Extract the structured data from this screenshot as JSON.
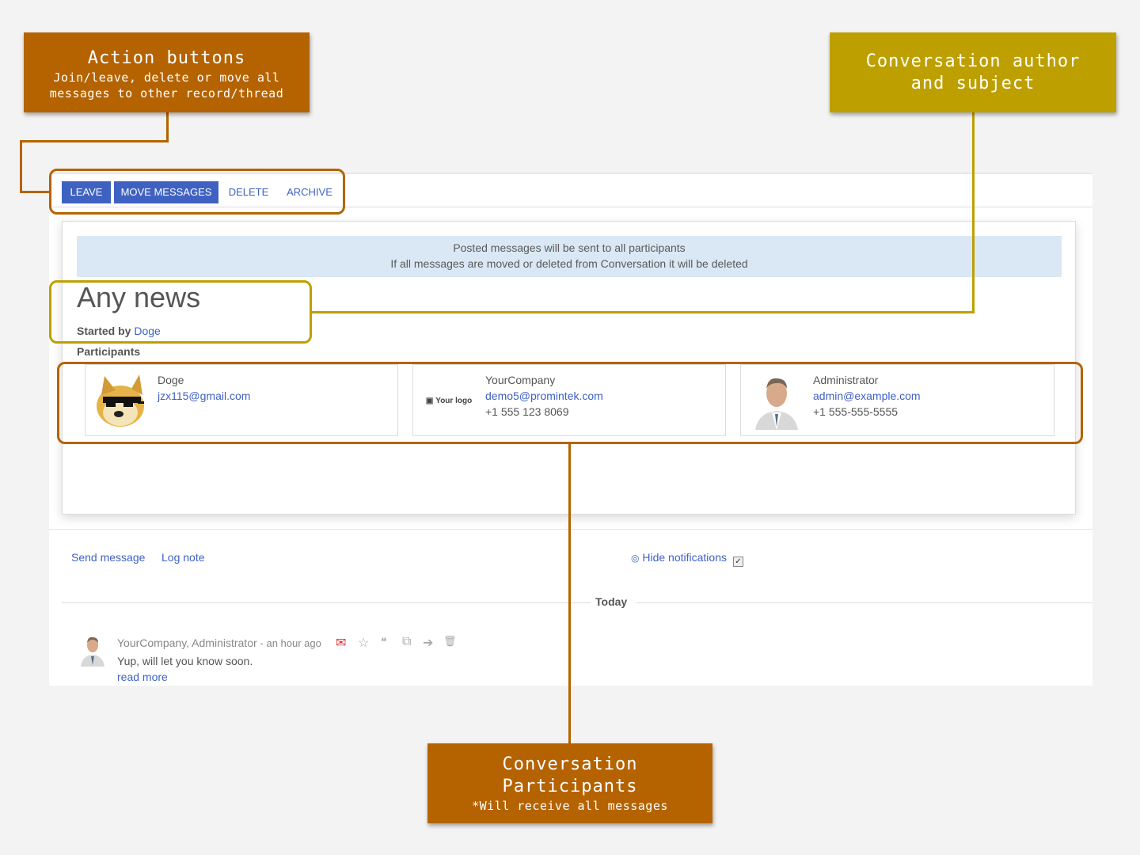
{
  "callouts": {
    "actions": {
      "title": "Action buttons",
      "subtitle": "Join/leave, delete or move all messages to other record/thread"
    },
    "author": {
      "title": "Conversation author and subject"
    },
    "participants": {
      "title": "Conversation Participants",
      "subtitle": "*Will receive all messages"
    }
  },
  "toolbar": {
    "leave_label": "LEAVE",
    "move_label": "MOVE MESSAGES",
    "delete_label": "DELETE",
    "archive_label": "ARCHIVE"
  },
  "banner": {
    "line1": "Posted messages will be sent to all participants",
    "line2": "If all messages are moved or deleted from Conversation it will be deleted"
  },
  "conversation": {
    "subject": "Any news",
    "started_by_label": "Started by",
    "author": "Doge",
    "participants_label": "Participants"
  },
  "participants": [
    {
      "name": "Doge",
      "email": "jzx115@gmail.com",
      "phone": ""
    },
    {
      "name": "YourCompany",
      "email": "demo5@promintek.com",
      "phone": "+1 555 123 8069",
      "logo_text": "Your logo"
    },
    {
      "name": "Administrator",
      "email": "admin@example.com",
      "phone": "+1 555-555-5555"
    }
  ],
  "chatter": {
    "send_message": "Send message",
    "log_note": "Log note",
    "hide_notifications": "Hide notifications",
    "today": "Today"
  },
  "message": {
    "author": "YourCompany, Administrator",
    "time": "- an hour ago",
    "body": "Yup, will let you know soon.",
    "read_more": "read more"
  },
  "colors": {
    "accent": "#3f62c2",
    "callout_orange": "#b56300",
    "callout_olive": "#bda000",
    "banner": "#d9e8f4"
  }
}
